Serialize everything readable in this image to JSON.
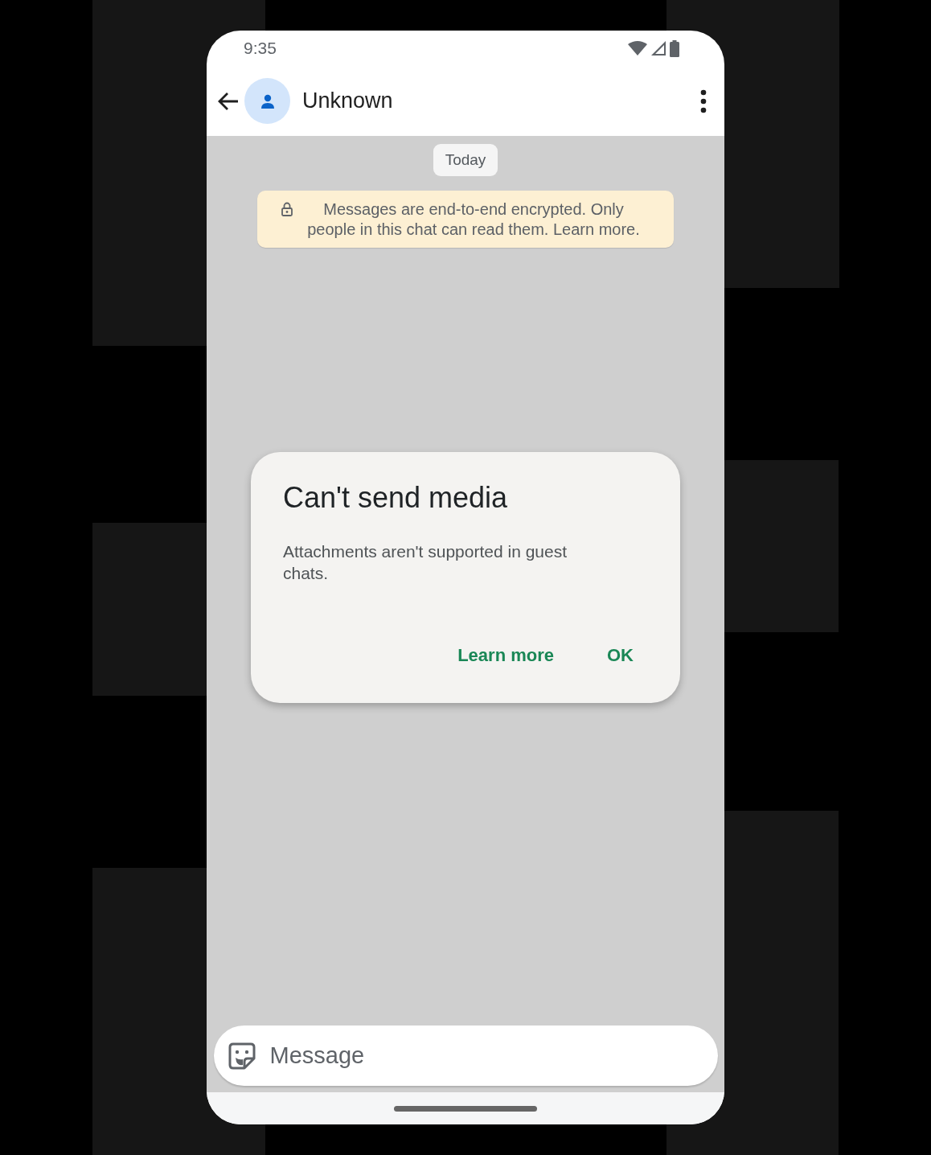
{
  "status_bar": {
    "time": "9:35"
  },
  "header": {
    "title": "Unknown"
  },
  "chat": {
    "date_chip": "Today",
    "encryption_notice": "Messages are end-to-end encrypted. Only people in this chat can read them. Learn more."
  },
  "dialog": {
    "title": "Can't send media",
    "body": "Attachments aren't supported in guest chats.",
    "buttons": [
      "Learn more",
      "OK"
    ]
  },
  "composer": {
    "placeholder": "Message"
  }
}
